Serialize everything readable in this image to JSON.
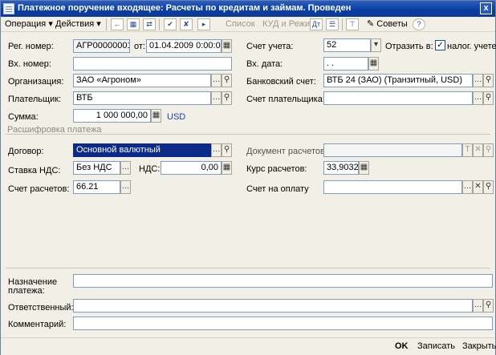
{
  "window": {
    "title": "Платежное поручение входящее: Расчеты по кредитам и займам. Проведен",
    "close": "x"
  },
  "toolbar": {
    "operation": "Операция",
    "actions": "Действия",
    "list": "Список",
    "kud": "КУД и Режим",
    "advice": "Советы",
    "help": "?"
  },
  "form": {
    "reg_number_label": "Рег. номер:",
    "reg_number": "АГР00000001",
    "from_label": "от:",
    "date": "01.04.2009  0:00:00",
    "account_label": "Счет учета:",
    "account": "52",
    "reflect_label": "Отразить в:",
    "tax_accounting_label": "налог. учете",
    "tax_accounting_check": "✓",
    "in_number_label": "Вх. номер:",
    "in_number": "",
    "in_date_label": "Вх. дата:",
    "in_date": " .  .",
    "org_label": "Организация:",
    "org": "ЗАО «Агроном»",
    "bank_account_label": "Банковский счет:",
    "bank_account": "ВТБ 24 (ЗАО) (Транзитный, USD)",
    "payer_label": "Плательщик:",
    "payer": "ВТБ",
    "payer_account_label": "Счет плательщика:",
    "payer_account": "",
    "sum_label": "Сумма:",
    "sum": "1 000 000,00",
    "currency": "USD"
  },
  "decoding": {
    "section_title": "Расшифровка платежа",
    "contract_label": "Договор:",
    "contract": "Основной валютный",
    "settlement_doc_label": "Документ расчетов:",
    "settlement_doc": "",
    "vat_rate_label": "Ставка НДС:",
    "vat_rate": "Без НДС",
    "vat_label": "НДС:",
    "vat": "0,00",
    "exchange_rate_label": "Курс расчетов:",
    "exchange_rate": "33,9032",
    "settlement_account_label": "Счет расчетов:",
    "settlement_account": "66.21",
    "invoice_label": "Счет на оплату",
    "invoice": ""
  },
  "bottom": {
    "purpose_label_1": "Назначение",
    "purpose_label_2": "платежа:",
    "purpose": "",
    "responsible_label": "Ответственный:",
    "responsible": "",
    "comment_label": "Комментарий:",
    "comment": ""
  },
  "footer": {
    "ok": "OK",
    "save": "Записать",
    "close": "Закрыть"
  }
}
